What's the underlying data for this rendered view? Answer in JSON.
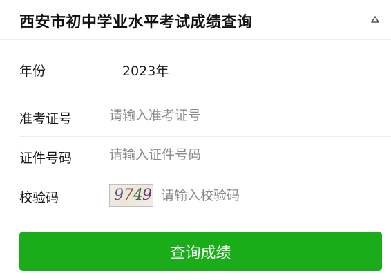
{
  "header": {
    "title": "西安市初中学业水平考试成绩查询",
    "collapse_icon": "triangle-up-icon"
  },
  "form": {
    "year": {
      "label": "年份",
      "value": "2023年"
    },
    "exam_number": {
      "label": "准考证号",
      "placeholder": "请输入准考证号"
    },
    "id_number": {
      "label": "证件号码",
      "placeholder": "请输入证件号码"
    },
    "captcha": {
      "label": "校验码",
      "placeholder": "请输入校验码",
      "image_text": [
        "9",
        "7",
        "4",
        "9"
      ],
      "image_colors": [
        "#5a5a8a",
        "#8a4a3a",
        "#3a6a4a",
        "#6a3a7a"
      ]
    },
    "submit_label": "查询成绩"
  },
  "colors": {
    "accent": "#1aad19",
    "divider": "#ececec",
    "placeholder": "#8a8a8a"
  }
}
